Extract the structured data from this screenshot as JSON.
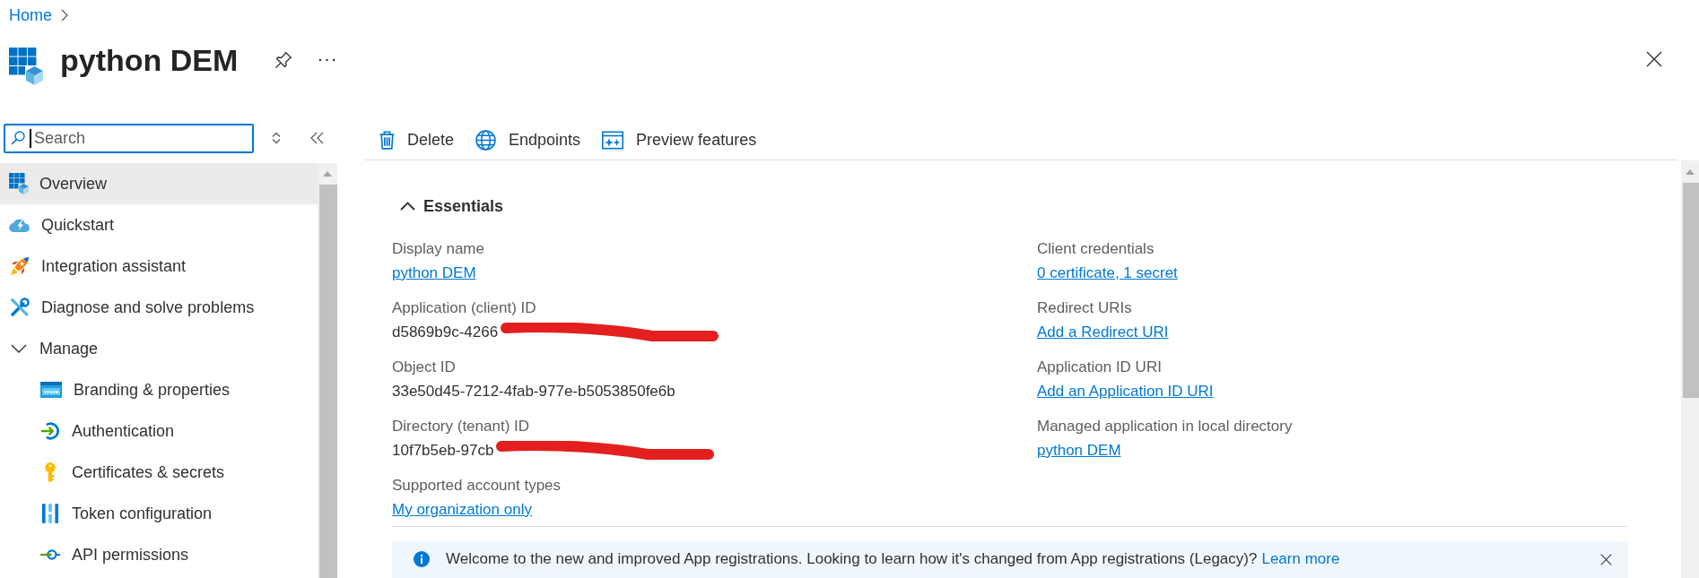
{
  "breadcrumb": [
    {
      "label": "Home"
    }
  ],
  "header": {
    "title": "python DEM"
  },
  "sidebar": {
    "search": {
      "placeholder": "Search",
      "focused": true
    },
    "items": [
      {
        "kind": "page",
        "label": "Overview",
        "selected": true
      },
      {
        "kind": "page",
        "label": "Quickstart",
        "selected": false
      },
      {
        "kind": "page",
        "label": "Integration assistant",
        "selected": false
      },
      {
        "kind": "page",
        "label": "Diagnose and solve problems",
        "selected": false
      },
      {
        "kind": "group",
        "label": "Manage",
        "selected": false,
        "expanded": true,
        "children": [
          {
            "label": "Branding & properties",
            "selected": false
          },
          {
            "label": "Authentication",
            "selected": false
          },
          {
            "label": "Certificates & secrets",
            "selected": false
          },
          {
            "label": "Token configuration",
            "selected": false
          },
          {
            "label": "API permissions",
            "selected": false
          }
        ]
      }
    ]
  },
  "toolbar": [
    {
      "label": "Delete"
    },
    {
      "label": "Endpoints"
    },
    {
      "label": "Preview features"
    }
  ],
  "essentials": {
    "title": "Essentials",
    "expanded": true,
    "left": [
      {
        "label": "Display name",
        "value": "python DEM",
        "kind": "link",
        "redacted": false
      },
      {
        "label": "Application (client) ID",
        "value": "d5869b9c-4266",
        "kind": "text",
        "redacted": true
      },
      {
        "label": "Object ID",
        "value": "33e50d45-7212-4fab-977e-b5053850fe6b",
        "kind": "text",
        "redacted": false
      },
      {
        "label": "Directory (tenant) ID",
        "value": "10f7b5eb-97cb",
        "kind": "text",
        "redacted": true
      },
      {
        "label": "Supported account types",
        "value": "My organization only",
        "kind": "link",
        "redacted": false
      }
    ],
    "right": [
      {
        "label": "Client credentials",
        "value": "0 certificate, 1 secret",
        "kind": "link",
        "redacted": false
      },
      {
        "label": "Redirect URIs",
        "value": "Add a Redirect URI",
        "kind": "link",
        "redacted": false
      },
      {
        "label": "Application ID URI",
        "value": "Add an Application ID URI",
        "kind": "link",
        "redacted": false
      },
      {
        "label": "Managed application in local directory",
        "value": "python DEM",
        "kind": "link",
        "redacted": false
      }
    ]
  },
  "banner": {
    "text": "Welcome to the new and improved App registrations. Looking to learn how it's changed from App registrations (Legacy)?",
    "link": "Learn more"
  }
}
